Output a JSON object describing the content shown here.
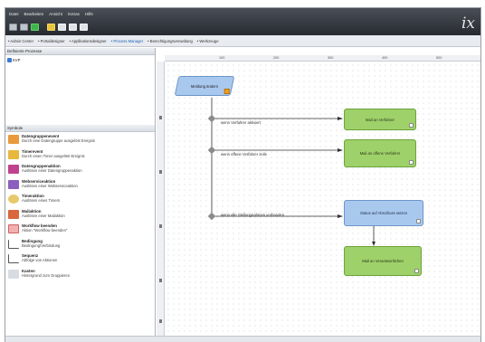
{
  "menubar": [
    "Datei",
    "Bearbeiten",
    "Ansicht",
    "Extras",
    "Hilfe"
  ],
  "brand": "ix",
  "nav_tabs": [
    {
      "label": "• Admin Center",
      "active": false
    },
    {
      "label": "• Portaldesigner",
      "active": false
    },
    {
      "label": "• Applikationsdesigner",
      "active": false
    },
    {
      "label": "• Process Manager",
      "active": true
    },
    {
      "label": "• Berechtigungsverwaltung",
      "active": false
    },
    {
      "label": "• Werkzeuge",
      "active": false
    }
  ],
  "sidebar": {
    "processes_header": "Definierte Prozesse",
    "tree_item": "KVP",
    "symbols_header": "Symbole",
    "symbols": [
      {
        "title": "Datengruppenevent",
        "desc": "Durch eine Datengruppe ausgelöst Ereignis",
        "color": "#e89a3c"
      },
      {
        "title": "Timerevent",
        "desc": "Durch einen Timer ausgelöst Ereignis",
        "color": "#e8b83c"
      },
      {
        "title": "Datengruppenaktion",
        "desc": "Auslösen einer Datengruppenaktion",
        "color": "#c0418e"
      },
      {
        "title": "Webserviceaktion",
        "desc": "Auslösen einer Webserviceaktion",
        "color": "#8b5fbf"
      },
      {
        "title": "Timeraktion",
        "desc": "Auslösen eines Timers",
        "color": "#e8c86a"
      },
      {
        "title": "Mailaktion",
        "desc": "Auslösen einer Mailaktion",
        "color": "#d9663c"
      },
      {
        "title": "Workflow beenden",
        "desc": "Aktion \"Workflow beenden\"",
        "color": "#e86a6a"
      },
      {
        "title": "Bedingung",
        "desc": "Bedingung/Verbindung",
        "color": "#ffffff"
      },
      {
        "title": "Sequenz",
        "desc": "Abfolge von Aktionen",
        "color": "#ffffff"
      },
      {
        "title": "Kasten",
        "desc": "Hintergrund zum Gruppieren",
        "color": "#d8dce2"
      }
    ]
  },
  "ruler": {
    "top": [
      "100",
      "200",
      "300",
      "400",
      "500"
    ]
  },
  "diagram": {
    "start": "Meldung ändern",
    "conditions": [
      "wenn Verfahrer aktiviert",
      "wenn offene Verfahrer zeile",
      "wenn alle Stellungnahmen vorhanden"
    ],
    "node_1": "Mail an Verfahrer",
    "node_2": "Mail an offene Verfahrer",
    "node_3": "Status auf Abschluss setzen",
    "node_4": "Mail an Verantwortlichen"
  }
}
